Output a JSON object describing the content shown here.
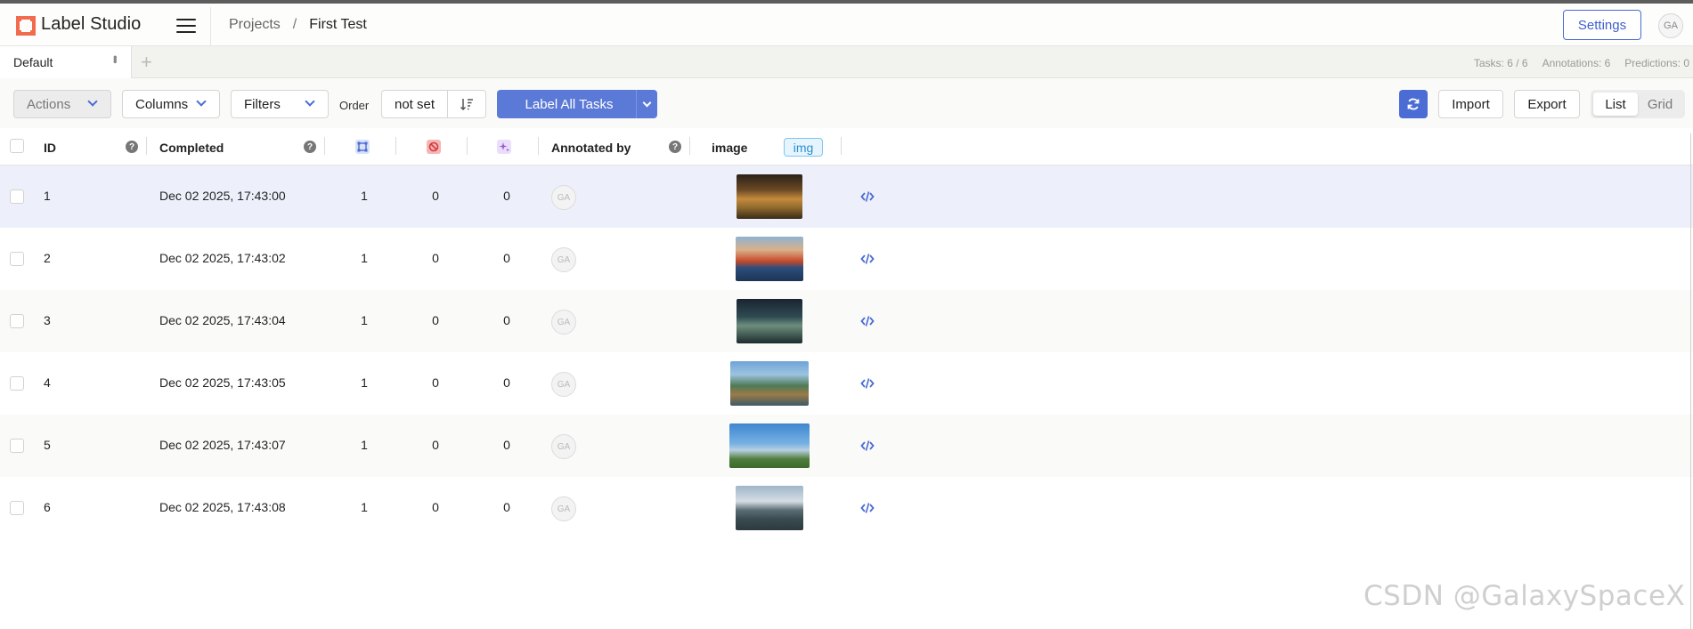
{
  "header": {
    "app_name": "Label Studio",
    "breadcrumb": {
      "projects": "Projects",
      "separator": "/",
      "current": "First Test"
    },
    "settings_label": "Settings",
    "avatar_initials": "GA"
  },
  "tabs": {
    "items": [
      {
        "label": "Default"
      }
    ],
    "add_symbol": "+",
    "stats": {
      "tasks": "Tasks: 6 / 6",
      "annotations": "Annotations: 6",
      "predictions": "Predictions: 0"
    }
  },
  "toolbar": {
    "actions_label": "Actions",
    "columns_label": "Columns",
    "filters_label": "Filters",
    "order_label": "Order",
    "order_value": "not set",
    "label_all_label": "Label All Tasks",
    "import_label": "Import",
    "export_label": "Export",
    "view_list": "List",
    "view_grid": "Grid",
    "accent_color": "#4a6cd4"
  },
  "table": {
    "columns": {
      "id": "ID",
      "completed": "Completed",
      "annotated_by": "Annotated by",
      "image": "image",
      "image_tag": "img",
      "help_symbol": "?"
    },
    "rows": [
      {
        "id": "1",
        "completed": "Dec 02 2025, 17:43:00",
        "total": "1",
        "cancelled": "0",
        "predictions": "0",
        "annotator": "GA",
        "image": "market-stall-photo",
        "selected": true
      },
      {
        "id": "2",
        "completed": "Dec 02 2025, 17:43:02",
        "total": "1",
        "cancelled": "0",
        "predictions": "0",
        "annotator": "GA",
        "image": "container-ship-photo",
        "selected": false
      },
      {
        "id": "3",
        "completed": "Dec 02 2025, 17:43:04",
        "total": "1",
        "cancelled": "0",
        "predictions": "0",
        "annotator": "GA",
        "image": "canal-town-night-photo",
        "selected": false
      },
      {
        "id": "4",
        "completed": "Dec 02 2025, 17:43:05",
        "total": "1",
        "cancelled": "0",
        "predictions": "0",
        "annotator": "GA",
        "image": "karst-river-boat-photo",
        "selected": false
      },
      {
        "id": "5",
        "completed": "Dec 02 2025, 17:43:07",
        "total": "1",
        "cancelled": "0",
        "predictions": "0",
        "annotator": "GA",
        "image": "city-skyline-photo",
        "selected": false
      },
      {
        "id": "6",
        "completed": "Dec 02 2025, 17:43:08",
        "total": "1",
        "cancelled": "0",
        "predictions": "0",
        "annotator": "GA",
        "image": "mountain-highway-photo",
        "selected": false
      }
    ]
  },
  "watermark": "CSDN @GalaxySpaceX"
}
